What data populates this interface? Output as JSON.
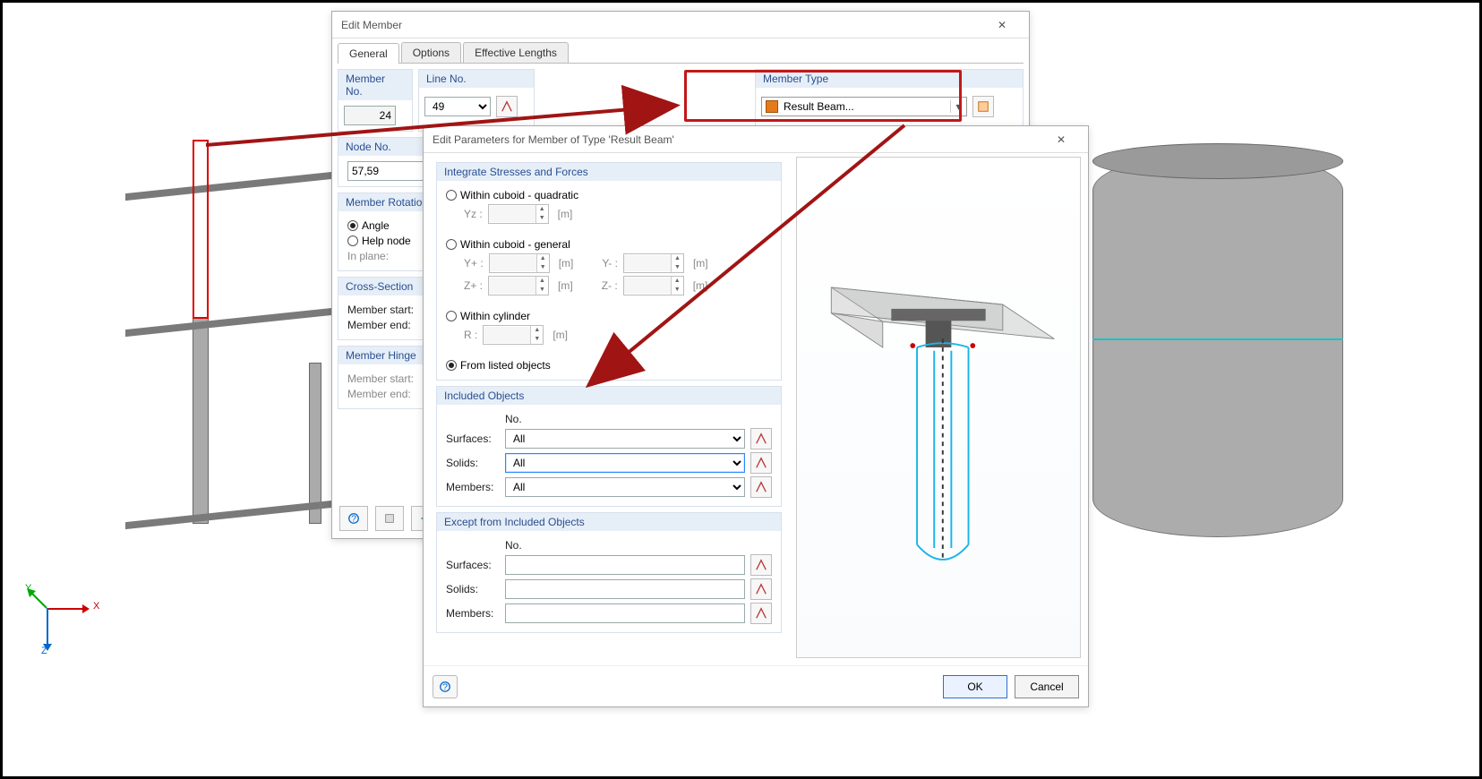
{
  "editMember": {
    "title": "Edit Member",
    "tabs": [
      "General",
      "Options",
      "Effective Lengths"
    ],
    "memberNo": {
      "label": "Member No.",
      "value": "24"
    },
    "lineNo": {
      "label": "Line No.",
      "value": "49"
    },
    "memberType": {
      "label": "Member Type",
      "value": "Result Beam..."
    },
    "nodeNo": {
      "label": "Node No.",
      "value": "57,59"
    },
    "rotation": {
      "header": "Member Rotation",
      "angle": "Angle",
      "help": "Help node",
      "inplane": "In plane:"
    },
    "cross": {
      "header": "Cross-Section",
      "start": "Member start:",
      "end": "Member end:"
    },
    "hinge": {
      "header": "Member Hinge",
      "start": "Member start:",
      "end": "Member end:"
    }
  },
  "params": {
    "title": "Edit Parameters for Member of Type 'Result Beam'",
    "integrate": {
      "header": "Integrate Stresses and Forces",
      "quadratic": "Within cuboid - quadratic",
      "general": "Within cuboid - general",
      "cylinder": "Within cylinder",
      "listed": "From listed objects",
      "Yz": "Yz :",
      "Yp": "Y+ :",
      "Ym": "Y- :",
      "Zp": "Z+ :",
      "Zm": "Z- :",
      "R": "R :",
      "unit": "[m]"
    },
    "included": {
      "header": "Included Objects",
      "no": "No.",
      "surfaces": "Surfaces:",
      "solids": "Solids:",
      "members": "Members:",
      "all": "All"
    },
    "except": {
      "header": "Except from Included Objects",
      "no": "No.",
      "surfaces": "Surfaces:",
      "solids": "Solids:",
      "members": "Members:"
    },
    "buttons": {
      "ok": "OK",
      "cancel": "Cancel"
    }
  },
  "axes": {
    "x": "X",
    "y": "Y",
    "z": "Z"
  }
}
